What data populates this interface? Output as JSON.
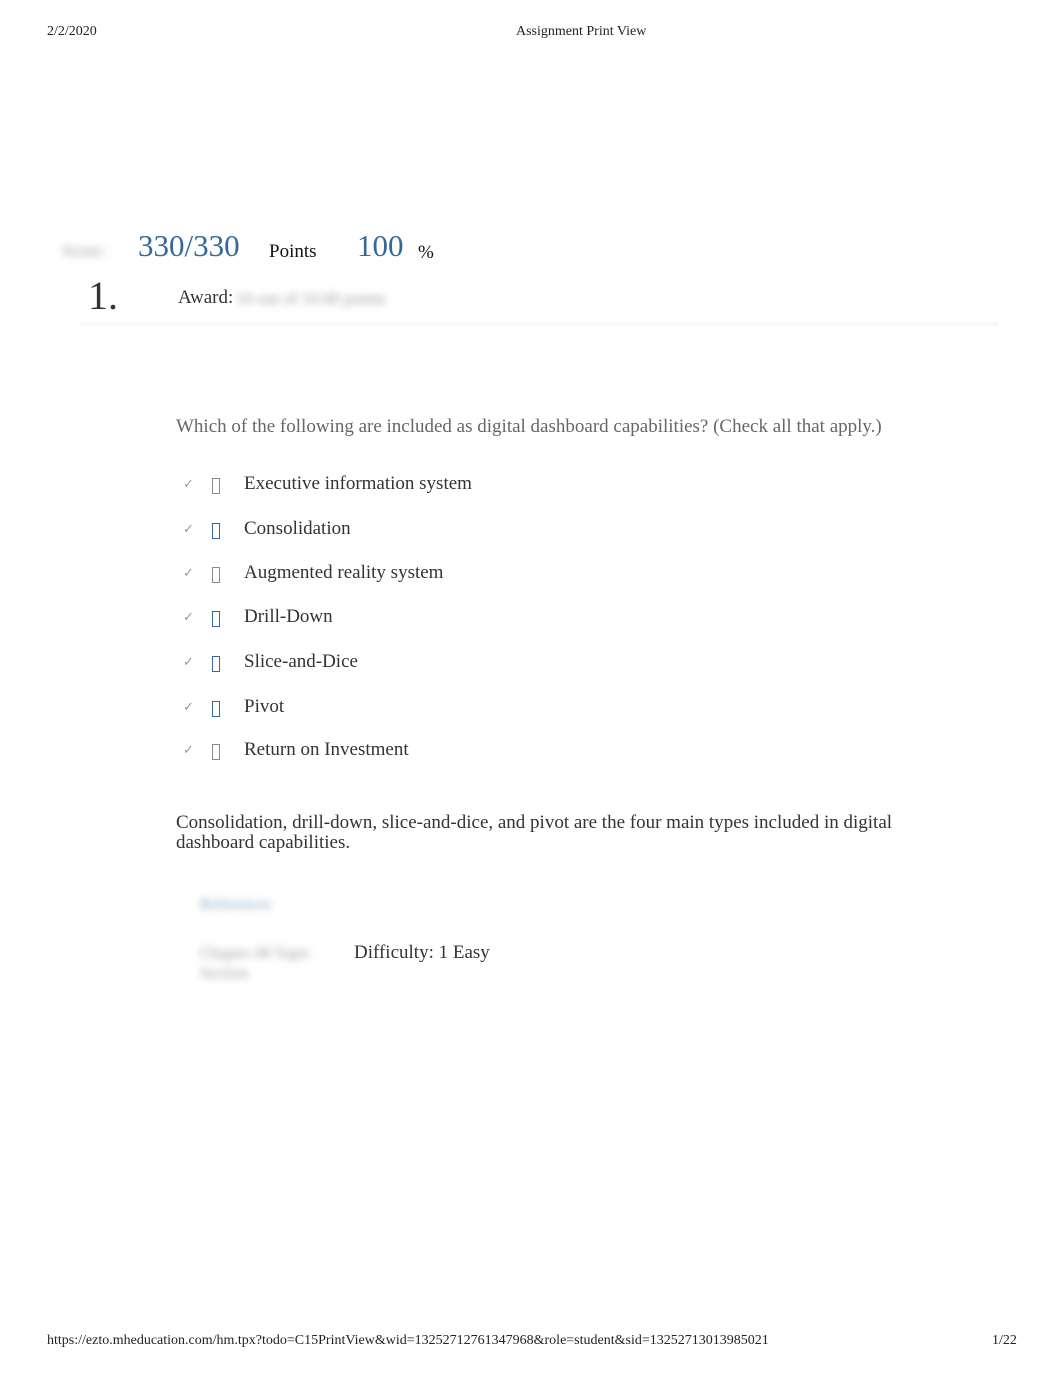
{
  "header": {
    "date": "2/2/2020",
    "title": "Assignment Print View"
  },
  "footer": {
    "url": "https://ezto.mheducation.com/hm.tpx?todo=C15PrintView&wid=13252712761347968&role=student&sid=13252713013985021",
    "page": "1/22"
  },
  "score": {
    "label": "Score:",
    "value": "330/330",
    "points_label": "Points",
    "percent": "100",
    "percent_sign": "%"
  },
  "question": {
    "number": "1.",
    "award_label": "Award:",
    "award_value": "10 out of 10.00 points",
    "prompt": "Which of the following are included as digital dashboard capabilities? (Check all that apply.)",
    "options": [
      {
        "label": "Executive information system",
        "checked": false
      },
      {
        "label": "Consolidation",
        "checked": true
      },
      {
        "label": "Augmented reality system",
        "checked": false
      },
      {
        "label": "Drill-Down",
        "checked": true
      },
      {
        "label": "Slice-and-Dice",
        "checked": true
      },
      {
        "label": "Pivot",
        "checked": true
      },
      {
        "label": "Return on Investment",
        "checked": false
      }
    ],
    "tick_glyph": "✓",
    "explanation": "Consolidation, drill-down, slice-and-dice, and pivot are the four main types included in digital dashboard capabilities.",
    "references_label": "References",
    "topic_label": "Chapter 08 Topic Section",
    "difficulty": "Difficulty: 1 Easy"
  },
  "colors": {
    "accent": "#35679a",
    "muted": "#999999",
    "text": "#333333"
  }
}
